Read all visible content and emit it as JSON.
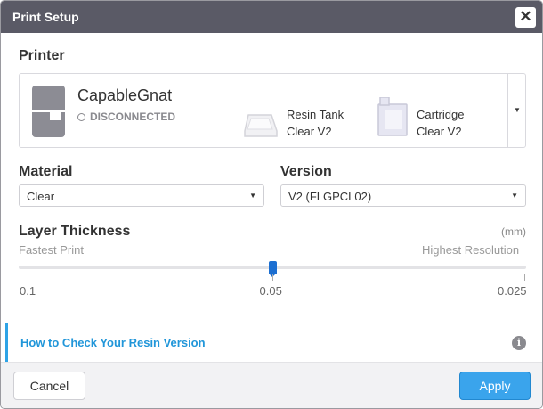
{
  "window": {
    "title": "Print Setup",
    "close_glyph": "✕"
  },
  "printer": {
    "section_label": "Printer",
    "name": "CapableGnat",
    "status": "DISCONNECTED",
    "resin_tank": {
      "line1": "Resin Tank",
      "line2": "Clear V2"
    },
    "cartridge": {
      "line1": "Cartridge",
      "line2": "Clear V2"
    },
    "dropdown_glyph": "▼"
  },
  "material": {
    "label": "Material",
    "selected": "Clear",
    "caret": "▼"
  },
  "version": {
    "label": "Version",
    "selected": "V2 (FLGPCL02)",
    "caret": "▼"
  },
  "layer_thickness": {
    "label": "Layer Thickness",
    "units": "(mm)",
    "left_hint": "Fastest Print",
    "right_hint": "Highest Resolution",
    "ticks": [
      "0.1",
      "0.05",
      "0.025"
    ],
    "selected_value": "0.05",
    "selected_index": 1
  },
  "info": {
    "link_text": "How to Check Your Resin Version",
    "icon_glyph": "i"
  },
  "footer": {
    "cancel_label": "Cancel",
    "apply_label": "Apply"
  },
  "colors": {
    "accent": "#3aa4ec",
    "titlebar": "#5a5a66",
    "slider_thumb": "#1c6fd1",
    "link": "#2196d9"
  }
}
